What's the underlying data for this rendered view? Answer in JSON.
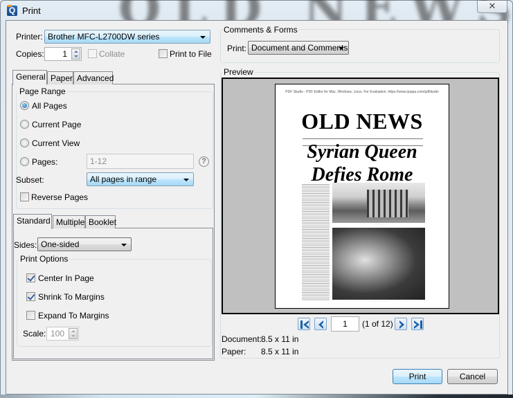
{
  "window": {
    "title": "Print",
    "background_headline": "OLD NEWS"
  },
  "printer": {
    "label": "Printer:",
    "selected": "Brother MFC-L2700DW series"
  },
  "copies": {
    "label": "Copies:",
    "value": "1",
    "collate_label": "Collate",
    "collate_checked": false,
    "collate_enabled": false,
    "print_to_file_label": "Print to File",
    "print_to_file_checked": false
  },
  "comments_forms": {
    "group_title": "Comments & Forms",
    "print_label": "Print:",
    "print_selected": "Document and Comments"
  },
  "main_tabs": [
    {
      "label": "General",
      "active": true
    },
    {
      "label": "Paper",
      "active": false
    },
    {
      "label": "Advanced",
      "active": false
    }
  ],
  "page_range": {
    "group_title": "Page Range",
    "options": [
      {
        "label": "All Pages",
        "checked": true
      },
      {
        "label": "Current Page",
        "checked": false
      },
      {
        "label": "Current View",
        "checked": false
      },
      {
        "label": "Pages:",
        "checked": false
      }
    ],
    "pages_value": "1-12",
    "help_icon": "?",
    "subset_label": "Subset:",
    "subset_selected": "All pages in range",
    "reverse_label": "Reverse Pages",
    "reverse_checked": false
  },
  "layout_tabs": [
    {
      "label": "Standard",
      "active": true
    },
    {
      "label": "Multiple",
      "active": false
    },
    {
      "label": "Booklet",
      "active": false
    }
  ],
  "standard": {
    "sides_label": "Sides:",
    "sides_selected": "One-sided",
    "print_options_title": "Print Options",
    "options": [
      {
        "label": "Center In Page",
        "checked": true
      },
      {
        "label": "Shrink To Margins",
        "checked": true
      },
      {
        "label": "Expand To Margins",
        "checked": false
      }
    ],
    "scale_label": "Scale:",
    "scale_value": "100"
  },
  "preview": {
    "group_title": "Preview",
    "page_content": {
      "eval_banner": "PDF Studio - PDF Editor for Mac, Windows, Linux. For Evaluation. https://www.qoppa.com/pdfstudio",
      "masthead": "OLD NEWS",
      "headline_line1": "Syrian Queen",
      "headline_line2": "Defies Rome"
    },
    "nav": {
      "first_icon": "first-page-icon",
      "prev_icon": "previous-page-icon",
      "current_page": "1",
      "page_of": "(1 of 12)",
      "next_icon": "next-page-icon",
      "last_icon": "last-page-icon"
    },
    "document_label": "Document:",
    "document_size": "8.5 x 11 in",
    "paper_label": "Paper:",
    "paper_size": "8.5 x 11 in"
  },
  "buttons": {
    "print": "Print",
    "cancel": "Cancel"
  },
  "colors": {
    "accent_button": "#bee6fd",
    "app_icon": "#1f5a9e"
  }
}
